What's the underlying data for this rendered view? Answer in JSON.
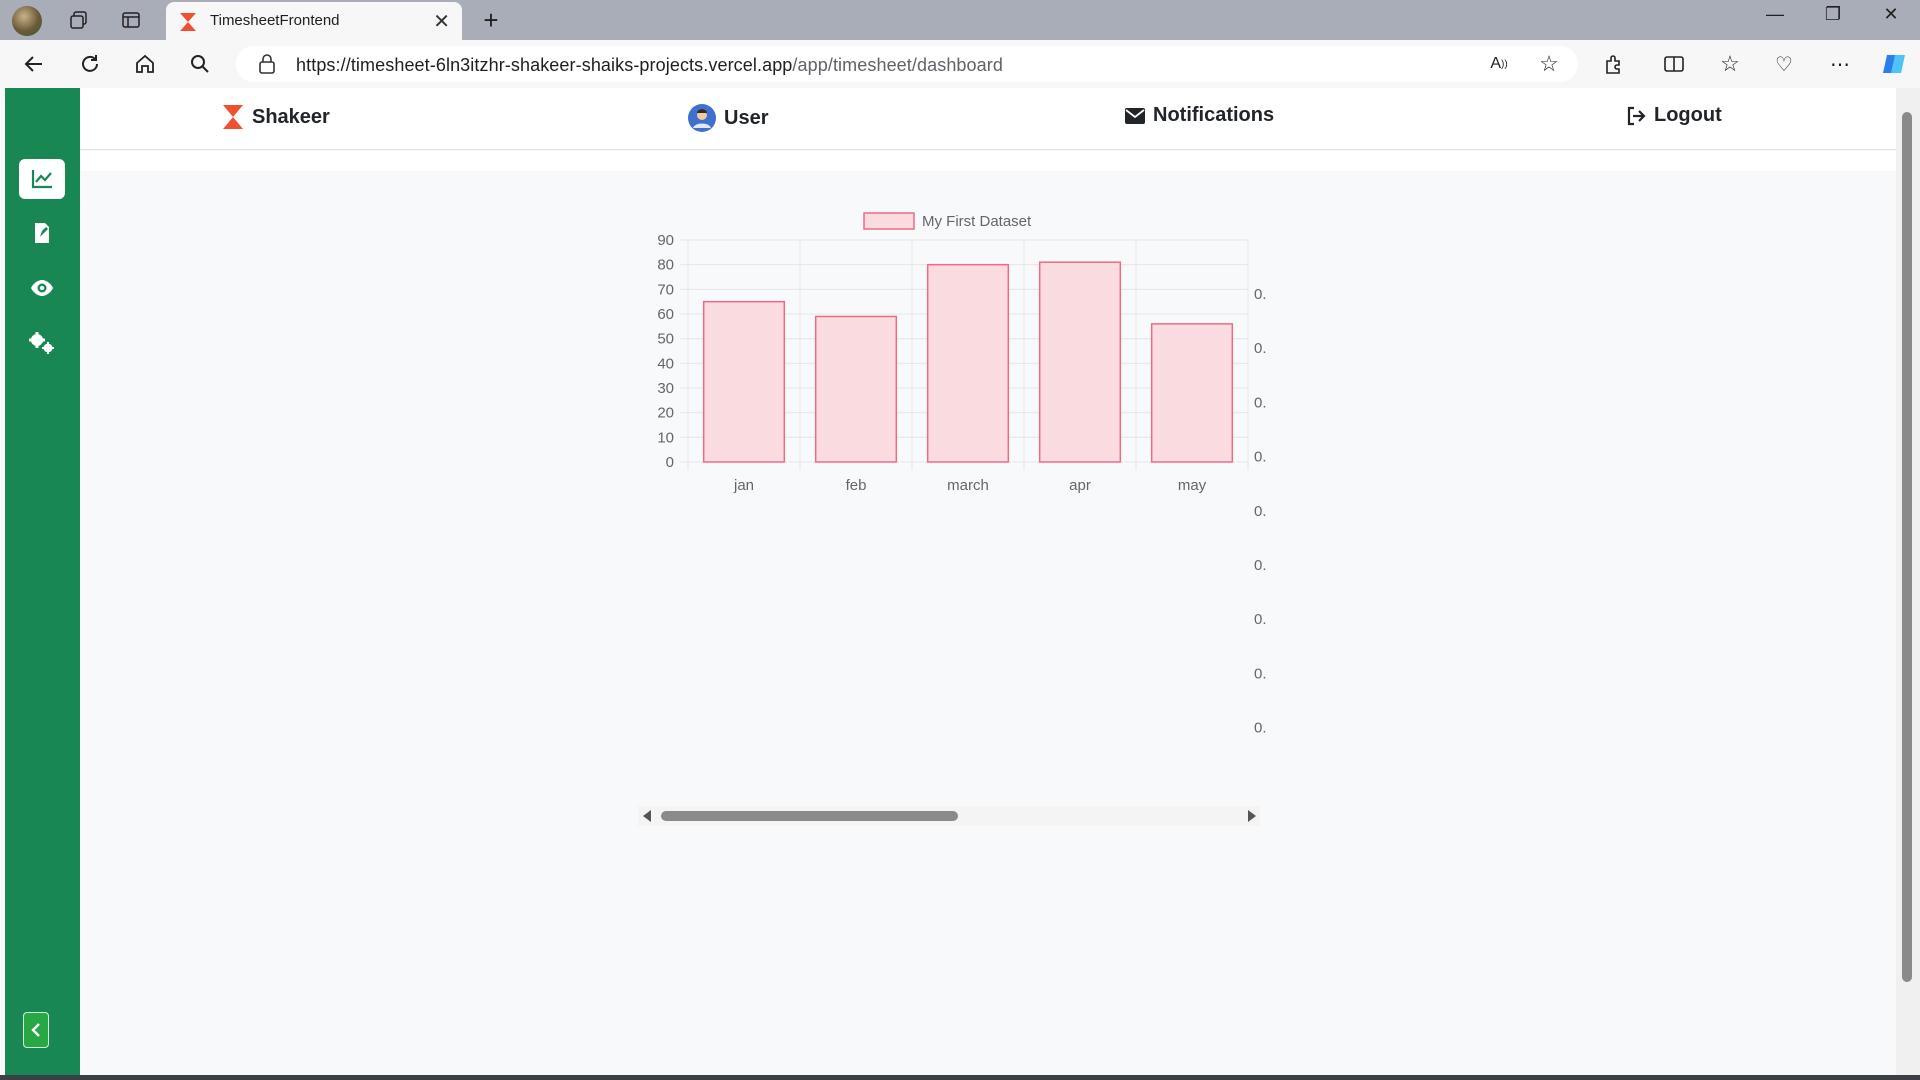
{
  "browser": {
    "tab_title": "TimesheetFrontend",
    "url_host": "https://timesheet-6ln3itzhr-shakeer-shaiks-projects.vercel.app",
    "url_path": "/app/timesheet/dashboard",
    "new_tab_symbol": "+"
  },
  "nav": {
    "brand": "Shakeer",
    "user": "User",
    "notifications": "Notifications",
    "logout": "Logout"
  },
  "sidebar": {
    "items": [
      {
        "icon": "chart-line-icon",
        "active": true
      },
      {
        "icon": "file-edit-icon",
        "active": false
      },
      {
        "icon": "eye-icon",
        "active": false
      },
      {
        "icon": "gears-icon",
        "active": false
      }
    ]
  },
  "colors": {
    "sidebar": "#198754",
    "accent": "#f05032",
    "bar_fill": "#fadbe0",
    "bar_border": "#ec6b86"
  },
  "chart_data": {
    "type": "bar",
    "legend": "My First Dataset",
    "categories": [
      "jan",
      "feb",
      "march",
      "apr",
      "may"
    ],
    "values": [
      65,
      59,
      80,
      81,
      56
    ],
    "ylim": [
      0,
      90
    ],
    "yticks": [
      "0",
      "10",
      "20",
      "30",
      "40",
      "50",
      "60",
      "70",
      "80",
      "90"
    ],
    "right_axis_ticks": [
      "0.",
      "0.",
      "0.",
      "0.",
      "0.",
      "0.",
      "0.",
      "0.",
      "0."
    ],
    "grid": true
  }
}
